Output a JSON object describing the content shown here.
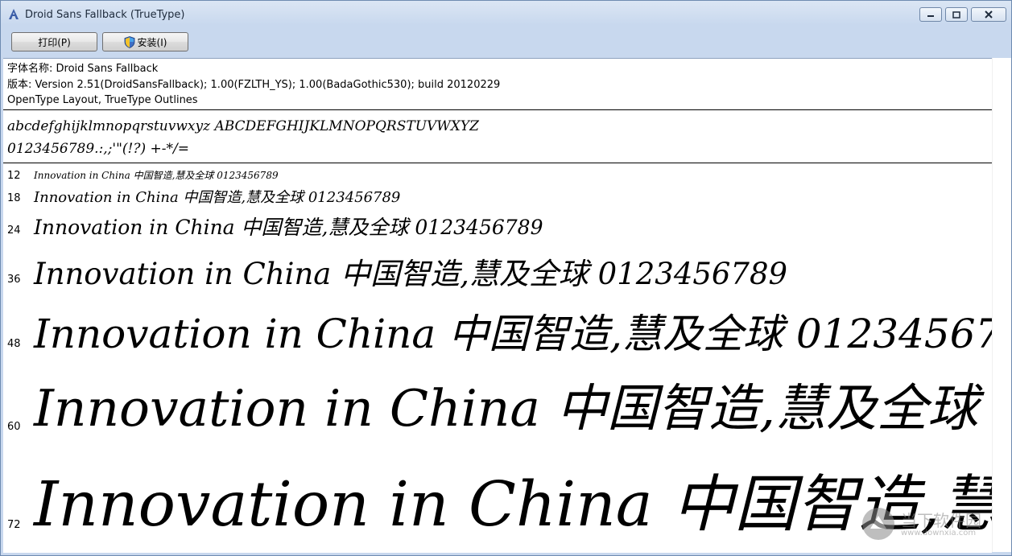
{
  "window": {
    "title": "Droid Sans Fallback (TrueType)"
  },
  "toolbar": {
    "print_label": "打印(P)",
    "install_label": "安装(I)"
  },
  "info": {
    "font_name": "字体名称: Droid Sans Fallback",
    "version": "版本: Version 2.51(DroidSansFallback); 1.00(FZLTH_YS); 1.00(BadaGothic530); build 20120229",
    "outlines": "OpenType Layout, TrueType Outlines"
  },
  "charset": {
    "letters": "abcdefghijklmnopqrstuvwxyz ABCDEFGHIJKLMNOPQRSTUVWXYZ",
    "digits": "0123456789.:,;'\"(!?) +-*/="
  },
  "preview_text": "Innovation in China 中国智造,慧及全球 0123456789",
  "preview_rows": [
    {
      "size": "12"
    },
    {
      "size": "18"
    },
    {
      "size": "24"
    },
    {
      "size": "36"
    },
    {
      "size": "48"
    },
    {
      "size": "60"
    },
    {
      "size": "72"
    }
  ],
  "watermark": {
    "line1": "当下软件园",
    "line2": "www.downxia.com"
  },
  "colors": {
    "titlebar": "#c8d8ee",
    "content_bg": "#ffffff",
    "text": "#000000"
  }
}
